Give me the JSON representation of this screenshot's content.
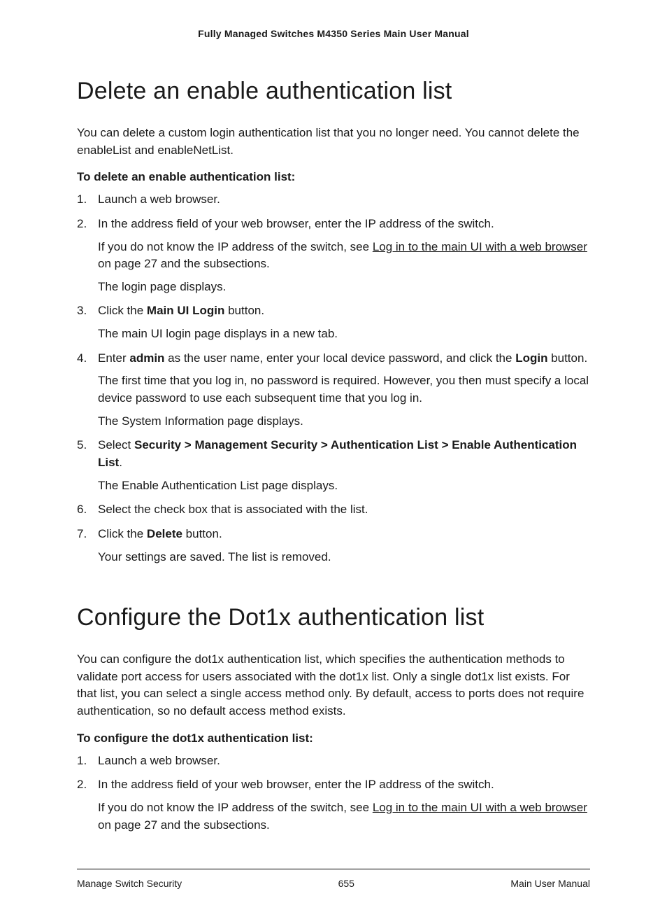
{
  "header": {
    "title": "Fully Managed Switches M4350 Series Main User Manual"
  },
  "section1": {
    "title": "Delete an enable authentication list",
    "intro": "You can delete a custom login authentication list that you no longer need. You cannot delete the enableList and enableNetList.",
    "subheader": "To delete an enable authentication list:",
    "s1": "Launch a web browser.",
    "s2": "In the address field of your web browser, enter the IP address of the switch.",
    "s2a_pre": "If you do not know the IP address of the switch, see ",
    "s2a_link": "Log in to the main UI with a web browser",
    "s2a_post": " on page 27 and the subsections.",
    "s2b": "The login page displays.",
    "s3_pre": "Click the ",
    "s3_bold": "Main UI Login",
    "s3_post": " button.",
    "s3a": "The main UI login page displays in a new tab.",
    "s4_pre": "Enter ",
    "s4_b1": "admin",
    "s4_mid": " as the user name, enter your local device password, and click the ",
    "s4_b2": "Login",
    "s4_post": " button.",
    "s4a": "The first time that you log in, no password is required. However, you then must specify a local device password to use each subsequent time that you log in.",
    "s4b": "The System Information page displays.",
    "s5_pre": "Select ",
    "s5_bold": "Security > Management Security > Authentication List > Enable Authentication List",
    "s5_post": ".",
    "s5a": "The Enable Authentication List page displays.",
    "s6": "Select the check box that is associated with the list.",
    "s7_pre": "Click the ",
    "s7_bold": "Delete",
    "s7_post": " button.",
    "s7a": "Your settings are saved. The list is removed."
  },
  "section2": {
    "title": "Configure the Dot1x authentication list",
    "intro": "You can configure the dot1x authentication list, which specifies the authentication methods to validate port access for users associated with the dot1x list. Only a single dot1x list exists. For that list, you can select a single access method only. By default, access to ports does not require authentication, so no default access method exists.",
    "subheader": "To configure the dot1x authentication list:",
    "s1": "Launch a web browser.",
    "s2": "In the address field of your web browser, enter the IP address of the switch.",
    "s2a_pre": "If you do not know the IP address of the switch, see ",
    "s2a_link": "Log in to the main UI with a web browser",
    "s2a_post": " on page 27 and the subsections."
  },
  "footer": {
    "left": "Manage Switch Security",
    "center": "655",
    "right": "Main User Manual"
  }
}
